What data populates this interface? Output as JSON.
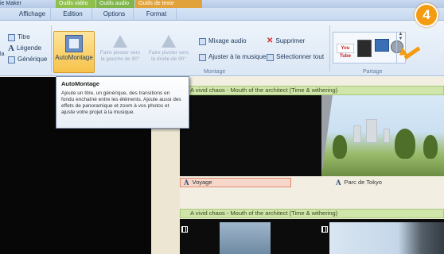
{
  "titlebar": {
    "app_title": "ie Maker",
    "context_tabs": [
      "Outils vidéo",
      "Outils audio",
      "Outils de texte"
    ]
  },
  "tabs": [
    "Affichage",
    "Edition",
    "Options",
    "Format"
  ],
  "ribbon": {
    "left_labels": {
      "la": "la",
      "titre": "Titre",
      "legende": "Légende",
      "generique": "Générique"
    },
    "automontage_label": "AutoMontage",
    "rotate_left_label": "Faire pivoter vers la gauche de 90°",
    "rotate_right_label": "Faire pivoter vers la droite de 90°",
    "mixage_audio": "Mixage audio",
    "supprimer": "Supprimer",
    "ajuster_musique": "Ajuster à la musique",
    "selectionner_tout": "Sélectionner tout",
    "group_montage": "Montage",
    "group_partage": "Partage",
    "youtube_label": "You Tube"
  },
  "callout": {
    "number": "4",
    "color": "#f39c12"
  },
  "tooltip": {
    "title": "AutoMontage",
    "body": "Ajoute un titre, un générique, des transitions en fondu enchaîné entre les éléments. Ajoute aussi des effets de panoramique et zoom à vos photos et ajuste votre projet à la musique."
  },
  "storyboard": {
    "music_band_1": "A vivid chaos - Mouth of the architect (Time & withering)",
    "music_band_2": "A vivid chaos - Mouth of the architect (Time & withering)",
    "captions": [
      "Voyage",
      "Parc de Tokyo"
    ],
    "caption_icon": "A"
  }
}
